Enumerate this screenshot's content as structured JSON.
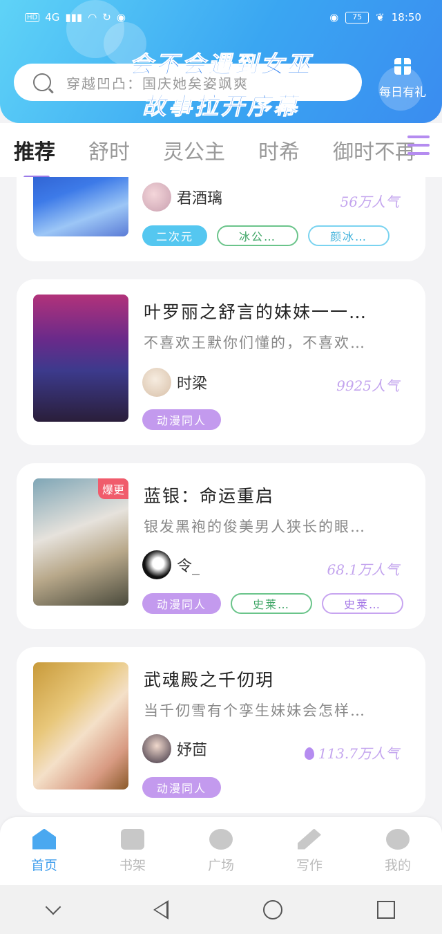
{
  "status_bar": {
    "network": "4G",
    "battery": "75",
    "time": "18:50"
  },
  "search": {
    "placeholder": "穿越凹凸：国庆她矣姿飒爽"
  },
  "banner": {
    "line1": "会不会遇到女巫",
    "line2": "故事拉开序幕"
  },
  "daily_gift": {
    "label": "每日有礼"
  },
  "tabs": [
    "推荐",
    "舒时",
    "灵公主",
    "时希",
    "御时不再"
  ],
  "cards": [
    {
      "author": "君酒璃",
      "popularity": "56万人气",
      "tags": [
        "二次元",
        "冰公…",
        "颜冰…"
      ]
    },
    {
      "title": "叶罗丽之舒言的妹妹一一…",
      "desc": "不喜欢王默你们懂的，不喜欢…",
      "author": "时梁",
      "popularity": "9925人气",
      "tags": [
        "动漫同人"
      ]
    },
    {
      "title": "蓝银：命运重启",
      "desc": "银发黑袍的俊美男人狭长的眼…",
      "author": "令_",
      "popularity": "68.1万人气",
      "badge": "爆更",
      "tags": [
        "动漫同人",
        "史莱…",
        "史莱…"
      ]
    },
    {
      "title": "武魂殿之千仞玥",
      "desc": "当千仞雪有个孪生妹妹会怎样…",
      "author": "妤茴",
      "popularity": "113.7万人气",
      "tags": [
        "动漫同人"
      ]
    }
  ],
  "bottom_nav": [
    "首页",
    "书架",
    "广场",
    "写作",
    "我的"
  ],
  "colors": {
    "accent": "#3aa6f2",
    "tag_purple": "#c39aee",
    "popularity": "#c3a4ee"
  }
}
